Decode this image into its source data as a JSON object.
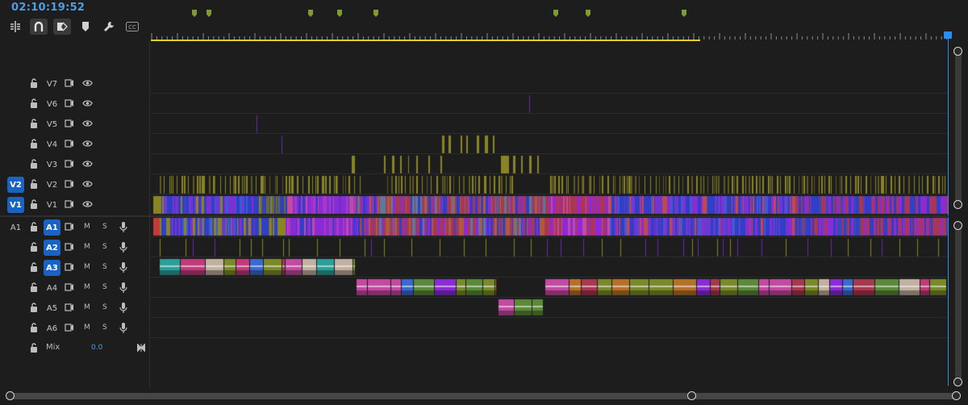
{
  "header": {
    "timecode": "02:10:19:52"
  },
  "toolbar": {
    "tools": [
      {
        "name": "insert-overwrite-sequences-icon",
        "active": false
      },
      {
        "name": "snap-magnet-icon",
        "active": true
      },
      {
        "name": "linked-selection-icon",
        "active": true
      },
      {
        "name": "add-marker-icon",
        "active": false
      },
      {
        "name": "timeline-settings-wrench-icon",
        "active": false
      },
      {
        "name": "captions-cc-icon",
        "active": false
      }
    ]
  },
  "markers": [
    52,
    70,
    196,
    232,
    277,
    500,
    540,
    659
  ],
  "video_tracks": [
    {
      "label": "V7",
      "source": ""
    },
    {
      "label": "V6",
      "source": ""
    },
    {
      "label": "V5",
      "source": ""
    },
    {
      "label": "V4",
      "source": ""
    },
    {
      "label": "V3",
      "source": ""
    },
    {
      "label": "V2",
      "source": "V2"
    },
    {
      "label": "V1",
      "source": "V1"
    }
  ],
  "audio_tracks": [
    {
      "label": "A1",
      "source": "A1",
      "targeted": true,
      "mute": "M",
      "solo": "S"
    },
    {
      "label": "A2",
      "source": "",
      "targeted": true,
      "mute": "M",
      "solo": "S"
    },
    {
      "label": "A3",
      "source": "",
      "targeted": true,
      "mute": "M",
      "solo": "S"
    },
    {
      "label": "A4",
      "source": "",
      "targeted": false,
      "mute": "M",
      "solo": "S"
    },
    {
      "label": "A5",
      "source": "",
      "targeted": false,
      "mute": "M",
      "solo": "S"
    },
    {
      "label": "A6",
      "source": "",
      "targeted": false,
      "mute": "M",
      "solo": "S"
    }
  ],
  "mix": {
    "label": "Mix",
    "value": "0.0"
  },
  "colors": {
    "accent": "#2d8ceb",
    "work_area": "#e2d21d",
    "marker": "#7f9a2f",
    "clip_olive": "#8a8424",
    "clip_blue": "#2f3fc6",
    "clip_purple": "#8b2bd6",
    "clip_red": "#a8384e",
    "clip_pink": "#c24aa0"
  }
}
